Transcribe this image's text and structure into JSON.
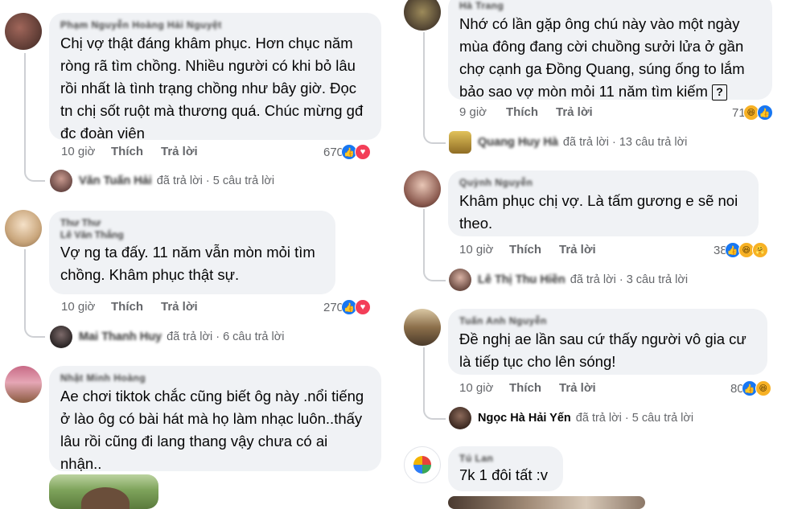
{
  "colors": {
    "bubble": "#f0f2f5",
    "meta_text": "#65676b",
    "like_blue": "#1877f2",
    "love_red": "#f33e58",
    "haha_yellow": "#f7b125"
  },
  "left_comments": [
    {
      "author": "Phạm Nguyễn Hoàng Hải Nguyệt",
      "text": "Chị vợ thật đáng khâm phục. Hơn chục năm ròng rã tìm chồng. Nhiều người có khi bỏ lâu rồi nhất là tình trạng chồng như bây giờ. Đọc tn chị sốt ruột mà thương quá. Chúc mừng gđ đc đoàn viên",
      "time": "10 giờ",
      "like": "Thích",
      "reply": "Trả lời",
      "reaction_count": "670",
      "reaction_icons": [
        "like-icon",
        "love-icon"
      ],
      "replies_name": "Văn Tuấn Hải",
      "replies_text": "đã trả lời · 5 câu trả lời"
    },
    {
      "author": "Thư Thư",
      "author2": "Lê Văn Thắng",
      "text": "Vợ ng ta đấy. 11 năm vẫn mòn mỏi tìm chồng. Khâm phục thật sự.",
      "time": "10 giờ",
      "like": "Thích",
      "reply": "Trả lời",
      "reaction_count": "270",
      "reaction_icons": [
        "like-icon",
        "love-icon"
      ],
      "replies_name": "Mai Thanh Huy",
      "replies_text": "đã trả lời · 6 câu trả lời"
    },
    {
      "author": "Nhật Minh Hoàng",
      "text": "Ae chơi tiktok chắc cũng biết ôg này .nổi tiếng ở lào ôg có bài hát mà họ làm nhạc luôn..thấy lâu rồi cũng đi lang thang vậy chưa có ai nhận.."
    }
  ],
  "right_comments": [
    {
      "author": "Hà Trang",
      "text": "Nhớ có lần gặp ông chú này vào một ngày mùa đông đang cời chuồng sưởi lửa ở gần chợ cạnh ga Đồng Quang, súng ống to lắm bảo sao vợ mòn mỏi 11 năm tìm kiếm",
      "unknown_glyph": "?",
      "time": "9 giờ",
      "like": "Thích",
      "reply": "Trả lời",
      "reaction_count": "71",
      "reaction_icons": [
        "haha-icon",
        "like-icon"
      ],
      "replies_name": "Quang Huy Hà",
      "replies_text": "đã trả lời · 13 câu trả lời"
    },
    {
      "author": "Quỳnh Nguyễn",
      "text": "Khâm phục chị vợ. Là tấm gương e sẽ noi theo.",
      "time": "10 giờ",
      "like": "Thích",
      "reply": "Trả lời",
      "reaction_count": "38",
      "reaction_icons": [
        "like-icon",
        "haha-icon",
        "care-icon"
      ],
      "replies_name": "Lê Thị Thu Hiền",
      "replies_text": "đã trả lời · 3 câu trả lời"
    },
    {
      "author": "Tuấn Anh Nguyễn",
      "text": "Đề nghị ae lần sau cứ thấy người vô gia cư là tiếp tục cho lên sóng!",
      "time": "10 giờ",
      "like": "Thích",
      "reply": "Trả lời",
      "reaction_count": "80",
      "reaction_icons": [
        "like-icon",
        "haha-icon"
      ],
      "replies_name": "Ngọc Hà Hải Yến",
      "replies_text": "đã trả lời · 5 câu trả lời"
    },
    {
      "author": "Tú Lan",
      "text": "7k 1 đôi tất :v"
    }
  ]
}
